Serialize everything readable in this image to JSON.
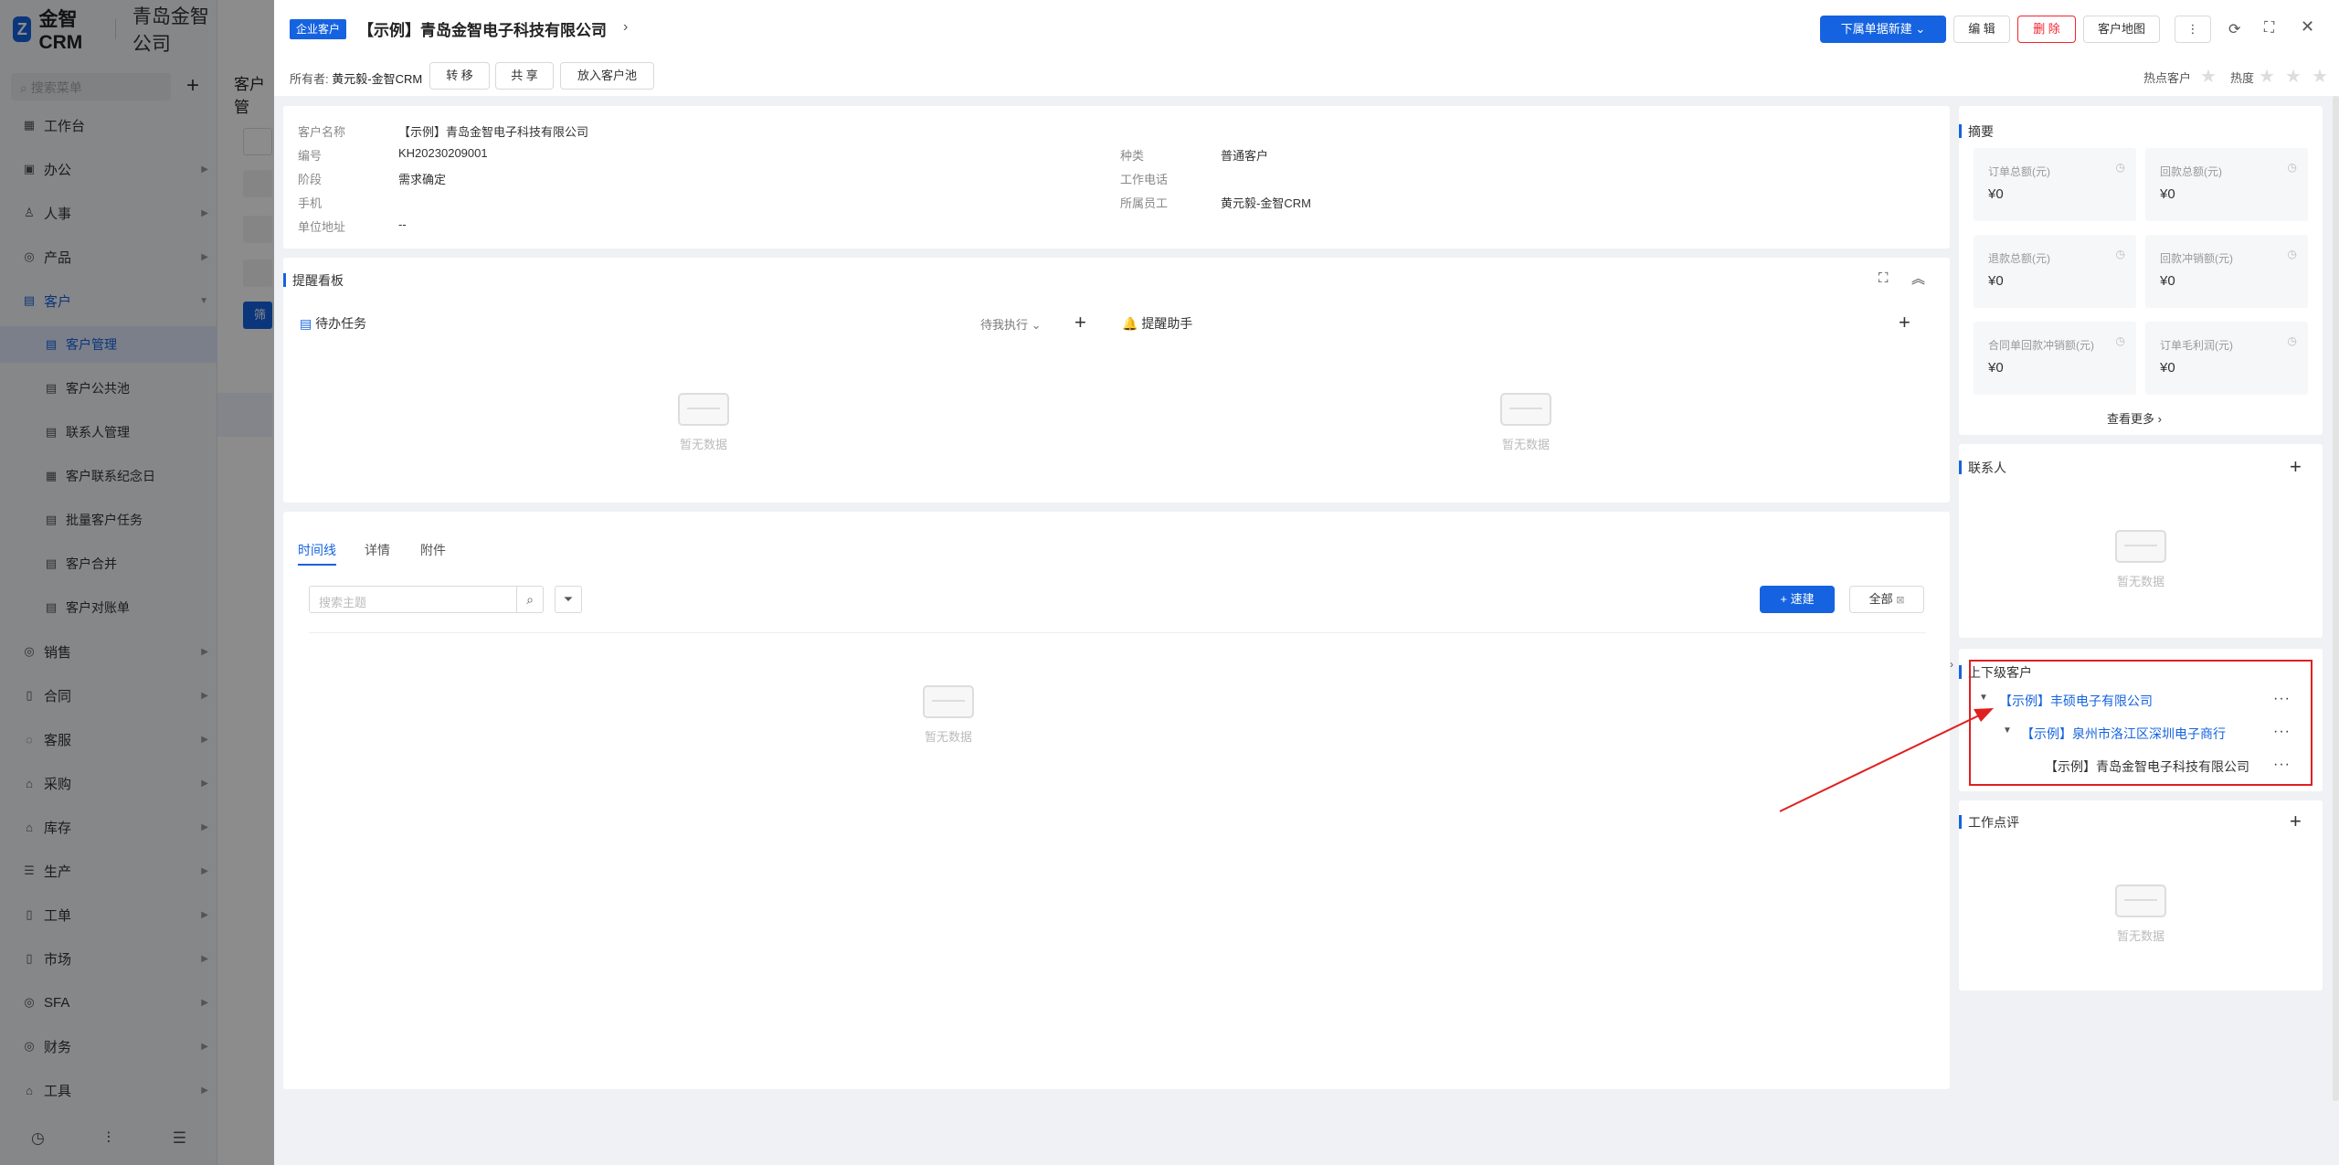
{
  "app": {
    "name": "金智CRM",
    "company": "青岛金智公司"
  },
  "sidebar": {
    "search_placeholder": "搜索菜单",
    "add": "+",
    "items": [
      {
        "label": "工作台",
        "icon": "dashboard-icon"
      },
      {
        "label": "办公",
        "icon": "office-icon"
      },
      {
        "label": "人事",
        "icon": "people-icon"
      },
      {
        "label": "产品",
        "icon": "product-icon"
      },
      {
        "label": "客户",
        "icon": "customer-icon"
      },
      {
        "label": "客户管理",
        "icon": "customer-manage-icon"
      },
      {
        "label": "客户公共池",
        "icon": "pool-icon"
      },
      {
        "label": "联系人管理",
        "icon": "contact-icon"
      },
      {
        "label": "客户联系纪念日",
        "icon": "calendar-icon"
      },
      {
        "label": "批量客户任务",
        "icon": "task-icon"
      },
      {
        "label": "客户合并",
        "icon": "merge-icon"
      },
      {
        "label": "客户对账单",
        "icon": "statement-icon"
      },
      {
        "label": "销售",
        "icon": "sales-icon"
      },
      {
        "label": "合同",
        "icon": "contract-icon"
      },
      {
        "label": "客服",
        "icon": "service-icon"
      },
      {
        "label": "采购",
        "icon": "purchase-icon"
      },
      {
        "label": "库存",
        "icon": "inventory-icon"
      },
      {
        "label": "生产",
        "icon": "production-icon"
      },
      {
        "label": "工单",
        "icon": "workorder-icon"
      },
      {
        "label": "市场",
        "icon": "market-icon"
      },
      {
        "label": "SFA",
        "icon": "sfa-icon"
      },
      {
        "label": "财务",
        "icon": "finance-icon"
      },
      {
        "label": "工具",
        "icon": "tools-icon"
      }
    ]
  },
  "background": {
    "page_title": "客户管",
    "filter_btn": "筛"
  },
  "header": {
    "tag": "企业客户",
    "title": "【示例】青岛金智电子科技有限公司",
    "owner_label": "所有者:",
    "owner": "黄元毅-金智CRM",
    "btn_transfer": "转 移",
    "btn_share": "共 享",
    "btn_pool": "放入客户池",
    "btn_new": "下属单据新建",
    "btn_edit": "编 辑",
    "btn_delete": "删 除",
    "btn_map": "客户地图",
    "hot_label": "热点客户",
    "heat_label": "热度"
  },
  "info": {
    "name_label": "客户名称",
    "name": "【示例】青岛金智电子科技有限公司",
    "code_label": "编号",
    "code": "KH20230209001",
    "stage_label": "阶段",
    "stage": "需求确定",
    "mobile_label": "手机",
    "mobile": "",
    "address_label": "单位地址",
    "address": "--",
    "type_label": "种类",
    "type": "普通客户",
    "phone_label": "工作电话",
    "phone": "",
    "staff_label": "所属员工",
    "staff": "黄元毅-金智CRM"
  },
  "reminder": {
    "title": "提醒看板",
    "todo": "待办任务",
    "todo_filter": "待我执行",
    "assistant": "提醒助手",
    "empty": "暂无数据"
  },
  "timeline": {
    "tabs": [
      "时间线",
      "详情",
      "附件"
    ],
    "search_placeholder": "搜索主题",
    "btn_quick": "速建",
    "btn_all": "全部",
    "empty": "暂无数据"
  },
  "summary": {
    "title": "摘要",
    "stats": [
      {
        "label": "订单总额(元)",
        "value": "¥0"
      },
      {
        "label": "回款总额(元)",
        "value": "¥0"
      },
      {
        "label": "退款总额(元)",
        "value": "¥0"
      },
      {
        "label": "回款冲销额(元)",
        "value": "¥0"
      },
      {
        "label": "合同单回款冲销额(元)",
        "value": "¥0"
      },
      {
        "label": "订单毛利润(元)",
        "value": "¥0"
      }
    ],
    "more": "查看更多"
  },
  "contacts": {
    "title": "联系人",
    "empty": "暂无数据"
  },
  "hierarchy": {
    "title": "上下级客户",
    "rows": [
      "【示例】丰硕电子有限公司",
      "【示例】泉州市洛江区深圳电子商行",
      "【示例】青岛金智电子科技有限公司"
    ]
  },
  "review": {
    "title": "工作点评",
    "empty": "暂无数据"
  },
  "colors": {
    "accent": "#1563e0",
    "danger": "#f5222d",
    "annotation": "#e02020"
  }
}
